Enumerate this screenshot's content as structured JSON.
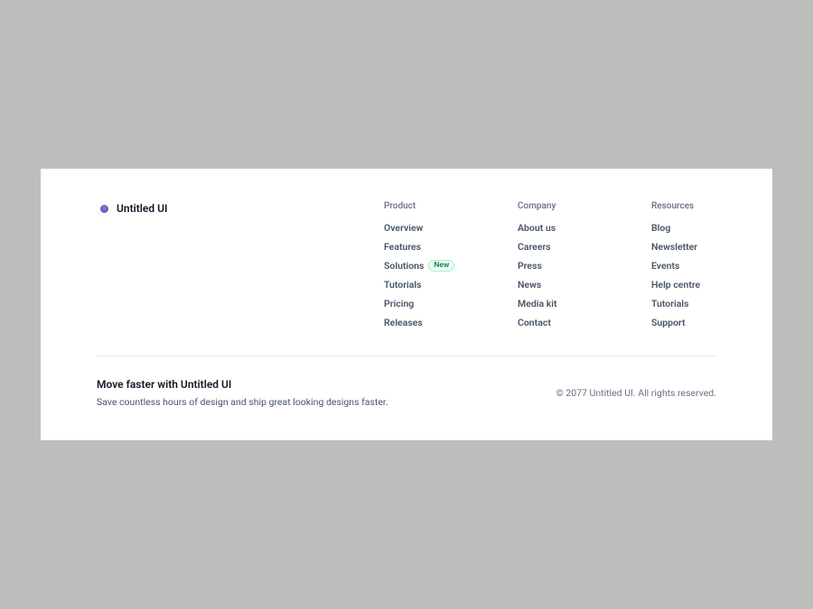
{
  "logo": {
    "text": "Untitled UI"
  },
  "columns": {
    "product": {
      "heading": "Product",
      "links": {
        "overview": "Overview",
        "features": "Features",
        "solutions": "Solutions",
        "solutions_badge": "New",
        "tutorials": "Tutorials",
        "pricing": "Pricing",
        "releases": "Releases"
      }
    },
    "company": {
      "heading": "Company",
      "links": {
        "about": "About us",
        "careers": "Careers",
        "press": "Press",
        "news": "News",
        "mediakit": "Media kit",
        "contact": "Contact"
      }
    },
    "resources": {
      "heading": "Resources",
      "links": {
        "blog": "Blog",
        "newsletter": "Newsletter",
        "events": "Events",
        "helpcentre": "Help centre",
        "tutorials": "Tutorials",
        "support": "Support"
      }
    }
  },
  "bottom": {
    "tagline": "Move faster with Untitled UI",
    "subtext": "Save countless hours of design and ship great looking designs faster.",
    "copyright": "© 2077 Untitled UI. All rights reserved."
  }
}
